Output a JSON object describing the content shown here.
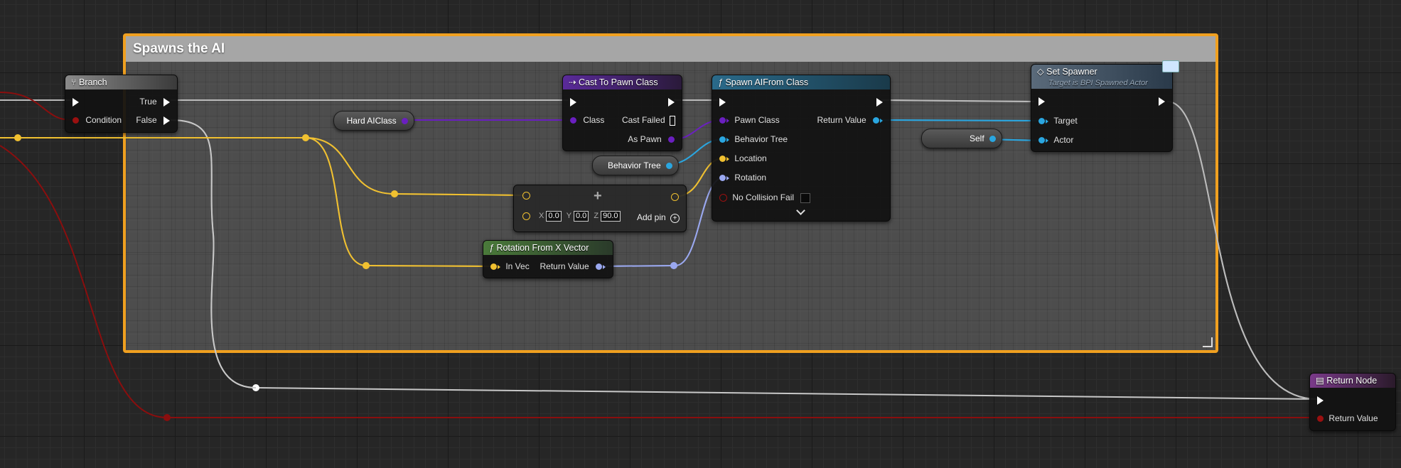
{
  "comment": {
    "title": "Spawns the AI"
  },
  "colors": {
    "exec": "#ffffff",
    "bool": "#9a1010",
    "class": "#6a1fc0",
    "object": "#2aa6e0",
    "vector": "#f0c030",
    "rotator": "#9aa8f0",
    "comment_border": "#f0a020"
  },
  "nodes": {
    "branch": {
      "title": "Branch",
      "icon": "branch-icon",
      "condition": "Condition",
      "true_label": "True",
      "false_label": "False"
    },
    "hard_ai_class": {
      "label": "Hard AIClass"
    },
    "cast": {
      "title": "Cast To Pawn Class",
      "icon": "cast-icon",
      "class_pin": "Class",
      "cast_failed": "Cast Failed",
      "as_pawn": "As Pawn"
    },
    "behavior_tree_var": {
      "label": "Behavior Tree"
    },
    "spawn": {
      "title": "Spawn AIFrom Class",
      "icon": "function-icon",
      "pawn_class": "Pawn Class",
      "behavior_tree": "Behavior Tree",
      "location": "Location",
      "rotation": "Rotation",
      "no_collision_fail": "No Collision Fail",
      "return_value": "Return Value",
      "expand_icon": "chevron-down-icon"
    },
    "add_vector": {
      "operator": "+",
      "x_label": "X",
      "x_value": "0.0",
      "y_label": "Y",
      "y_value": "0.0",
      "z_label": "Z",
      "z_value": "90.0",
      "add_pin": "Add pin",
      "add_pin_icon": "plus-circle-icon"
    },
    "rotation_from_x": {
      "title": "Rotation From X Vector",
      "icon": "function-icon",
      "in_vec": "In Vec",
      "return_value": "Return Value"
    },
    "self_var": {
      "label": "Self"
    },
    "set_spawner": {
      "title": "Set Spawner",
      "subtitle": "Target is BPI Spawned Actor",
      "icon": "interface-icon",
      "message_icon": "envelope-icon",
      "target": "Target",
      "actor": "Actor"
    },
    "return_node": {
      "title": "Return Node",
      "icon": "return-icon",
      "return_value": "Return Value"
    }
  }
}
